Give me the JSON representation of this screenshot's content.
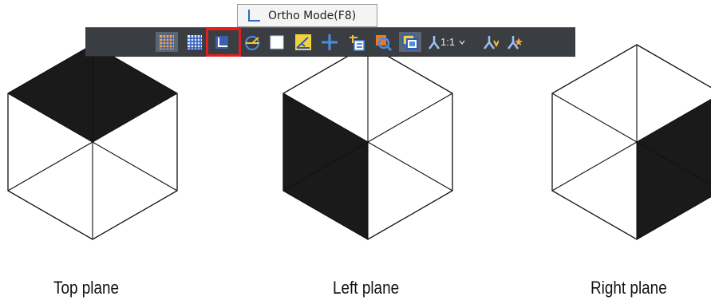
{
  "tooltip": {
    "text": "Ortho Mode(F8)",
    "icon": "ortho-mode-icon"
  },
  "toolbar": {
    "buttons": [
      {
        "icon": "grid-display-icon",
        "active": true
      },
      {
        "icon": "snap-mode-icon",
        "active": false
      },
      {
        "icon": "ortho-mode-icon",
        "active": false,
        "highlighted": true
      },
      {
        "icon": "polar-tracking-icon",
        "active": false
      },
      {
        "icon": "object-snap-icon",
        "active": false
      },
      {
        "icon": "isometric-drafting-icon",
        "active": false
      },
      {
        "icon": "object-snap-tracking-icon",
        "active": false
      },
      {
        "icon": "lineweight-icon",
        "active": false
      },
      {
        "icon": "transparency-icon",
        "active": false
      },
      {
        "icon": "selection-cycling-icon",
        "active": true
      },
      {
        "icon": "annotation-scale-icon",
        "active": false
      },
      {
        "icon": "annotation-visibility-icon",
        "active": false
      },
      {
        "icon": "auto-scale-icon",
        "active": false
      }
    ],
    "scale_text": "1:1",
    "scale_dropdown_icon": "chevron-down-icon",
    "highlight_color": "#e02020"
  },
  "planes": [
    {
      "caption": "Top plane",
      "filled_face": "top"
    },
    {
      "caption": "Left plane",
      "filled_face": "left"
    },
    {
      "caption": "Right plane",
      "filled_face": "right"
    }
  ],
  "colors": {
    "fill": "#1a1a1a",
    "stroke": "#111111",
    "toolbar_bg": "#3a3d42"
  }
}
